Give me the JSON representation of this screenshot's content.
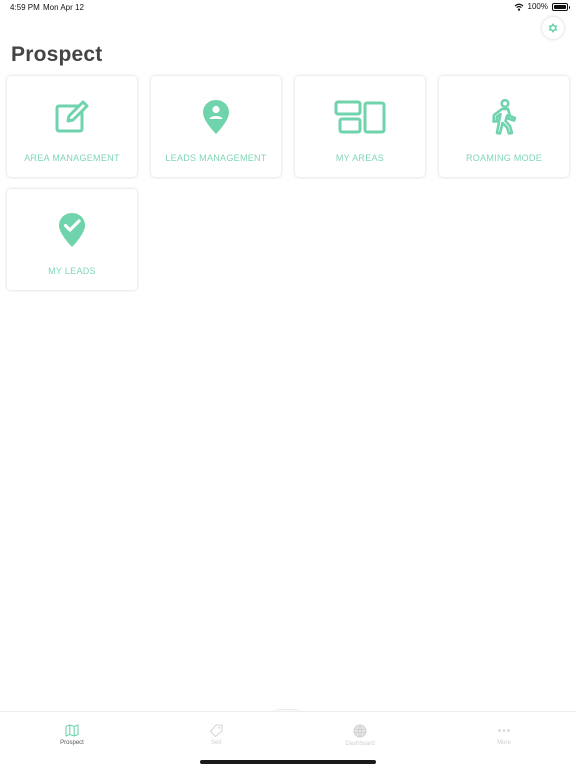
{
  "status_bar": {
    "time": "4:59 PM",
    "date": "Mon Apr 12",
    "battery_text": "100%",
    "battery_level": 1.0
  },
  "page": {
    "title": "Prospect"
  },
  "settings": {
    "icon": "gear-icon"
  },
  "colors": {
    "accent": "#6fd3ac",
    "accent_light": "#7fd6b4",
    "title": "#444444",
    "inactive": "#cfcfcf"
  },
  "tiles": [
    {
      "label": "AREA MANAGEMENT",
      "icon": "edit-icon"
    },
    {
      "label": "LEADS MANAGEMENT",
      "icon": "location-user-icon"
    },
    {
      "label": "MY AREAS",
      "icon": "layout-icon"
    },
    {
      "label": "ROAMING MODE",
      "icon": "walking-icon"
    },
    {
      "label": "MY LEADS",
      "icon": "location-check-icon"
    }
  ],
  "tab_bar": {
    "tabs": [
      {
        "label": "Prospect",
        "icon": "map-icon",
        "active": true
      },
      {
        "label": "Sell",
        "icon": "tag-icon",
        "active": false
      },
      {
        "label": "Dashboard",
        "icon": "globe-icon",
        "active": false
      },
      {
        "label": "More",
        "icon": "more-icon",
        "active": false
      }
    ]
  }
}
